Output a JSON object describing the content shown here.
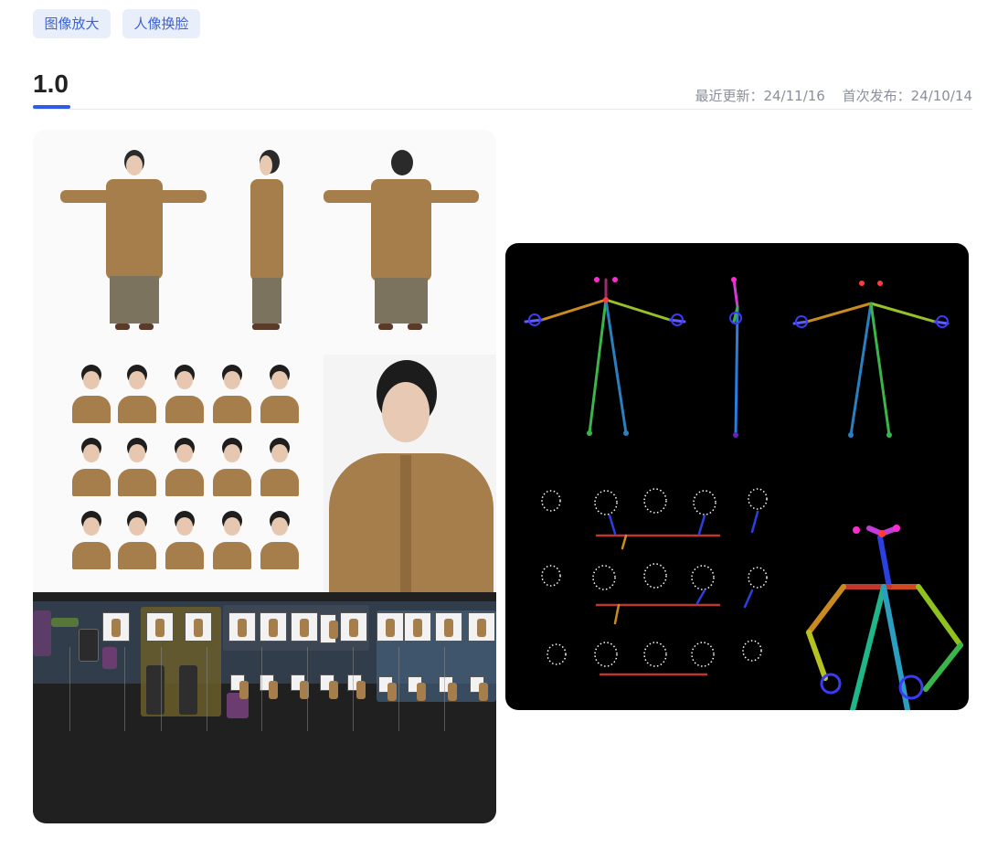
{
  "tags": [
    {
      "label": "图像放大"
    },
    {
      "label": "人像换脸"
    }
  ],
  "version": {
    "label": "1.0"
  },
  "dates": {
    "updated": "最近更新：24/11/16",
    "published": "首次发布：24/10/14"
  },
  "images": [
    {
      "icon": "character-sheet-image"
    },
    {
      "icon": "pose-skeleton-image"
    }
  ],
  "colors": {
    "accent": "#2f5bea",
    "tag_bg": "#e9eefb",
    "tag_text": "#3d63d6",
    "muted_text": "#8a8f99"
  }
}
